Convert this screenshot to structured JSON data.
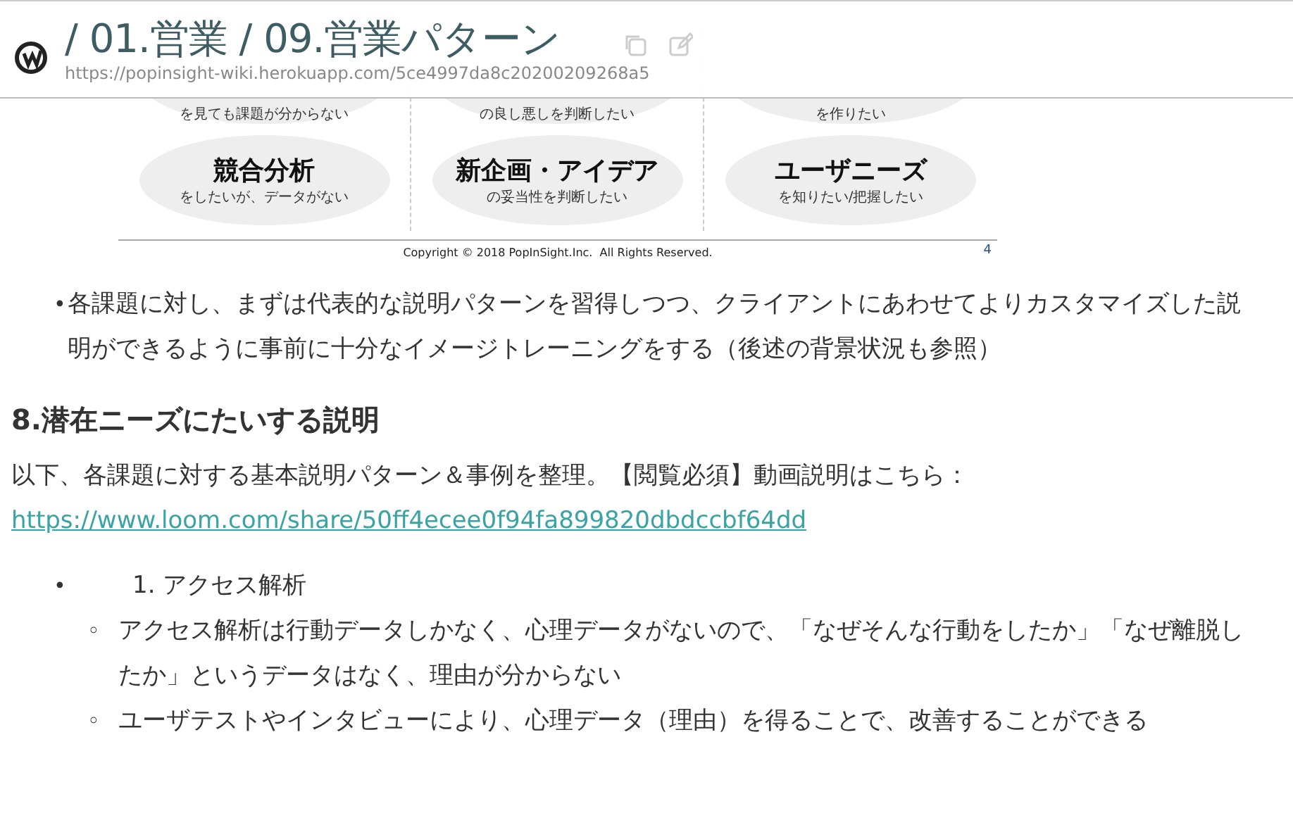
{
  "header": {
    "title": "/ 01.営業 / 09.営業パターン",
    "url": "https://popinsight-wiki.herokuapp.com/5ce4997da8c20200209268a5"
  },
  "slide": {
    "rows": [
      [
        {
          "subtitle": "を見ても課題が分からない"
        },
        {
          "subtitle": "の良し悪しを判断したい"
        },
        {
          "subtitle": "を作りたい"
        }
      ],
      [
        {
          "title": "競合分析",
          "subtitle": "をしたいが、データがない"
        },
        {
          "title": "新企画・アイデア",
          "subtitle": "の妥当性を判断したい"
        },
        {
          "title": "ユーザニーズ",
          "subtitle": "を知りたい/把握したい"
        }
      ]
    ],
    "copyright": "Copyright © 2018 PopInSight.Inc.  All Rights Reserved.",
    "page": "4"
  },
  "bullets": [
    {
      "marker": "•",
      "text": "各課題に対し、まずは代表的な説明パターンを習得しつつ、クライアントにあわせてよりカスタマイズした説明ができるように事前に十分なイメージトレーニングをする（後述の背景状況も参照）"
    }
  ],
  "heading": "8.潜在ニーズにたいする説明",
  "paragraph": "以下、各課題に対する基本説明パターン＆事例を整理。【閲覧必須】動画説明はこちら：",
  "link": "https://www.loom.com/share/50ff4ecee0f94fa899820dbdccbf64dd",
  "outline": [
    {
      "marker": "•",
      "number": "1.",
      "label": "アクセス解析",
      "children": [
        {
          "marker": "◦",
          "text": "アクセス解析は行動データしかなく、心理データがないので、「なぜそんな行動をしたか」「なぜ離脱したか」というデータはなく、理由が分からない"
        },
        {
          "marker": "◦",
          "text": "ユーザテストやインタビューにより、心理データ（理由）を得ることで、改善することができる"
        }
      ]
    }
  ]
}
